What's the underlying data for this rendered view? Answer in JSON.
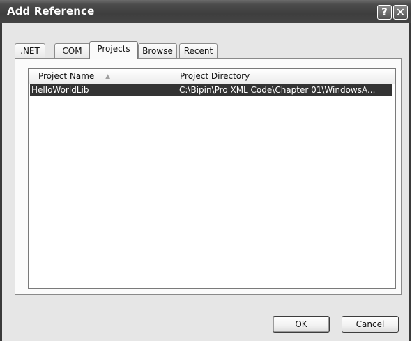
{
  "window": {
    "title": "Add Reference",
    "help_label": "?",
    "close_label": "✕",
    "icons": {
      "help": "help-icon",
      "close": "close-icon"
    }
  },
  "tabs": [
    {
      "label": ".NET",
      "active": false
    },
    {
      "label": "COM",
      "active": false
    },
    {
      "label": "Projects",
      "active": true
    },
    {
      "label": "Browse",
      "active": false
    },
    {
      "label": "Recent",
      "active": false
    }
  ],
  "list": {
    "columns": [
      {
        "label": "Project Name",
        "sorted": "ascending"
      },
      {
        "label": "Project Directory"
      }
    ],
    "sort_indicator": "▲",
    "rows": [
      {
        "name": "HelloWorldLib",
        "directory": "C:\\Bipin\\Pro XML Code\\Chapter 01\\WindowsA...",
        "selected": true
      }
    ]
  },
  "buttons": {
    "ok_label": "OK",
    "cancel_label": "Cancel"
  },
  "colors": {
    "selection_background": "#333333",
    "title_bar": "#3e3e3e"
  }
}
